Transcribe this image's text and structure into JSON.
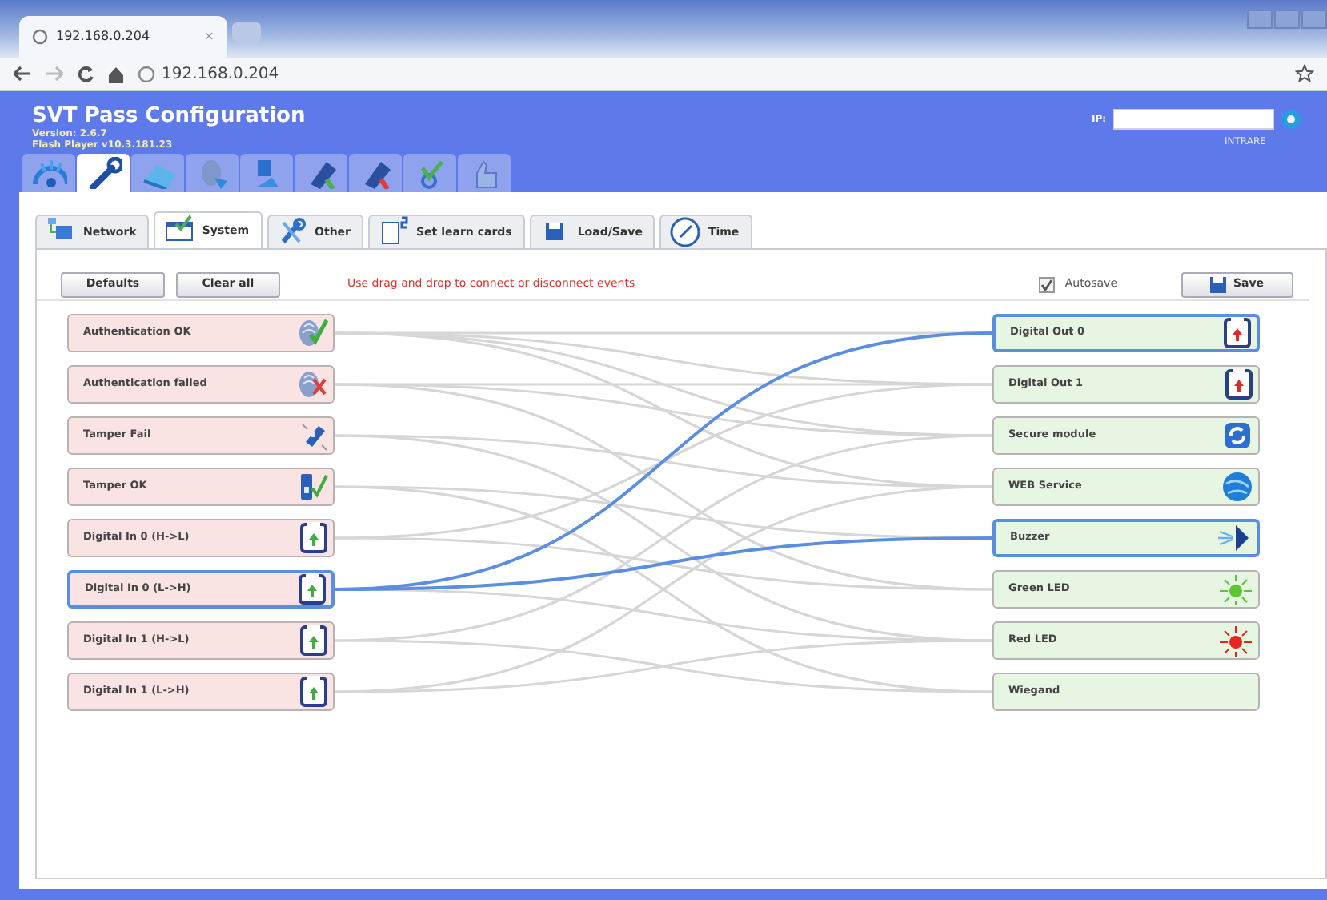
{
  "browser": {
    "tab_title": "192.168.0.204",
    "tab_close": "×",
    "url": "192.168.0.204"
  },
  "header": {
    "title": "SVT Pass Configuration",
    "version": "Version: 2.6.7",
    "player": "Flash Player v10.3.181.23",
    "ip_label": "IP:",
    "login": "INTRARE"
  },
  "header_tabs": [
    {
      "selected": false
    },
    {
      "selected": true
    },
    {
      "selected": false
    },
    {
      "selected": false
    },
    {
      "selected": false
    },
    {
      "selected": false
    },
    {
      "selected": false
    },
    {
      "selected": false
    },
    {
      "selected": false
    }
  ],
  "tabs": [
    {
      "label": "Network",
      "kind": "network",
      "selected": false
    },
    {
      "label": "System",
      "kind": "system",
      "selected": true
    },
    {
      "label": "Other",
      "kind": "other",
      "selected": false
    },
    {
      "label": "Set learn cards",
      "kind": "cards",
      "selected": false
    },
    {
      "label": "Load/Save",
      "kind": "disk",
      "selected": false
    },
    {
      "label": "Time",
      "kind": "clock",
      "selected": false
    }
  ],
  "toolbar": {
    "buttons": [
      "Defaults",
      "Clear all"
    ],
    "hint": "Use drag and drop to connect or disconnect events",
    "autosave": {
      "label": "Autosave",
      "checked": true
    },
    "save": "Save"
  },
  "events": [
    {
      "label": "Authentication OK",
      "kind": "auth",
      "passed": true,
      "selected": false
    },
    {
      "label": "Authentication failed",
      "kind": "auth",
      "passed": false,
      "selected": false
    },
    {
      "label": "Tamper Fail",
      "kind": "tamper",
      "passed": false,
      "selected": false
    },
    {
      "label": "Tamper OK",
      "kind": "tamper",
      "passed": true,
      "selected": false
    },
    {
      "label": "Digital In 0 (H->L)",
      "kind": "input",
      "selected": false
    },
    {
      "label": "Digital In 0 (L->H)",
      "kind": "input",
      "selected": true
    },
    {
      "label": "Digital In 1 (H->L)",
      "kind": "input",
      "selected": false
    },
    {
      "label": "Digital In 1 (L->H)",
      "kind": "input",
      "selected": false
    }
  ],
  "actions": [
    {
      "label": "Digital Out 0",
      "kind": "output",
      "selected": true
    },
    {
      "label": "Digital Out 1",
      "kind": "output",
      "selected": false
    },
    {
      "label": "Secure module",
      "kind": "secure",
      "selected": false
    },
    {
      "label": "WEB Service",
      "kind": "web",
      "selected": false
    },
    {
      "label": "Buzzer",
      "kind": "buzzer",
      "selected": true
    },
    {
      "label": "Green LED",
      "kind": "led",
      "color": "#5cc72e",
      "selected": false
    },
    {
      "label": "Red LED",
      "kind": "led",
      "color": "#e8241c",
      "selected": false
    },
    {
      "label": "Wiegand",
      "kind": "wiegand",
      "selected": false
    }
  ]
}
